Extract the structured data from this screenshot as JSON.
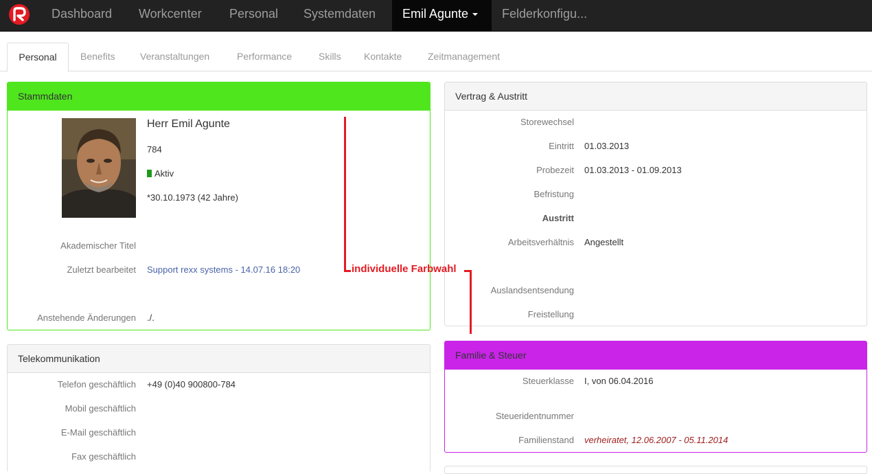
{
  "topnav": {
    "items": [
      "Dashboard",
      "Workcenter",
      "Personal",
      "Systemdaten"
    ],
    "user_menu": "Emil Agunte",
    "truncated_item": "Felderkonfigu..."
  },
  "tabs": [
    "Personal",
    "Benefits",
    "Veranstaltungen",
    "Performance",
    "Skills",
    "Kontakte",
    "Zeitmanagement"
  ],
  "stammdaten": {
    "title": "Stammdaten",
    "name": "Herr Emil Agunte",
    "id": "784",
    "status": "Aktiv",
    "birth": "*30.10.1973 (42 Jahre)",
    "akad_titel_label": "Akademischer Titel",
    "zuletzt_label": "Zuletzt bearbeitet",
    "zuletzt_value": "Support rexx systems - 14.07.16 18:20",
    "anstehend_label": "Anstehende Änderungen",
    "anstehend_value": "./."
  },
  "telekom": {
    "title": "Telekommunikation",
    "rows": [
      {
        "label": "Telefon geschäftlich",
        "value": "+49 (0)40 900800-784"
      },
      {
        "label": "Mobil geschäftlich",
        "value": ""
      },
      {
        "label": "E-Mail geschäftlich",
        "value": ""
      },
      {
        "label": "Fax geschäftlich",
        "value": ""
      }
    ]
  },
  "vertrag": {
    "title": "Vertrag & Austritt",
    "storewechsel": "Storewechsel",
    "eintritt_label": "Eintritt",
    "eintritt_value": "01.03.2013",
    "probezeit_label": "Probezeit",
    "probezeit_value": "01.03.2013 - 01.09.2013",
    "befristung": "Befristung",
    "austritt": "Austritt",
    "arbeitsverhaeltnis_label": "Arbeitsverhältnis",
    "arbeitsverhaeltnis_value": "Angestellt",
    "auslandsentsendung": "Auslandsentsendung",
    "freistellung": "Freistellung"
  },
  "familie": {
    "title": "Familie & Steuer",
    "steuerklasse_label": "Steuerklasse",
    "steuerklasse_value": "I, von 06.04.2016",
    "steuerid_label": "Steueridentnummer",
    "familienstand_label": "Familienstand",
    "familienstand_value": "verheiratet, 12.06.2007 - 05.11.2014"
  },
  "annotation": "individuelle Farbwahl",
  "colors": {
    "stammdaten_header": "#4fe61e",
    "familie_header": "#c924e8",
    "annotation": "#e21b23",
    "status_active": "#1e9a1e"
  },
  "icons": [
    "rexx-logo-icon",
    "caret-down-icon",
    "status-active-icon"
  ]
}
